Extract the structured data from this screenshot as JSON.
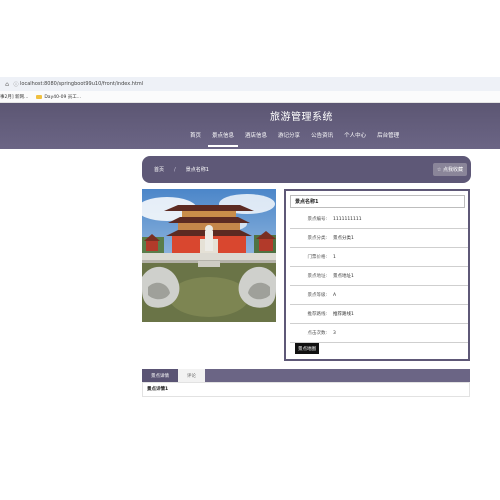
{
  "browser": {
    "url": "localhost:8080/springboot99u10/front/index.html",
    "bookmarks": [
      "事2月] 新网...",
      "Day40-09 员工..."
    ]
  },
  "header": {
    "site_title": "旅游管理系统",
    "nav": [
      "首页",
      "景点信息",
      "酒店信息",
      "游记分享",
      "公告资讯",
      "个人中心",
      "后台管理"
    ]
  },
  "breadcrumb": {
    "home": "首页",
    "separator": "/",
    "current": "景点名称1",
    "favorite_label": "☆ 点我收藏"
  },
  "detail": {
    "title": "景点名称1",
    "rows": [
      {
        "label": "景点编号:",
        "value": "1111111111"
      },
      {
        "label": "景点分类:",
        "value": "景点分类1"
      },
      {
        "label": "门票价格:",
        "value": "1"
      },
      {
        "label": "景点地址:",
        "value": "景点地址1"
      },
      {
        "label": "景点等级:",
        "value": "A"
      },
      {
        "label": "推荐路线:",
        "value": "推荐路线1"
      },
      {
        "label": "点击次数:",
        "value": "3"
      }
    ],
    "map_button": "景点地图"
  },
  "tabs": {
    "items": [
      "景点详情",
      "评论"
    ],
    "content": "景点详情1"
  }
}
